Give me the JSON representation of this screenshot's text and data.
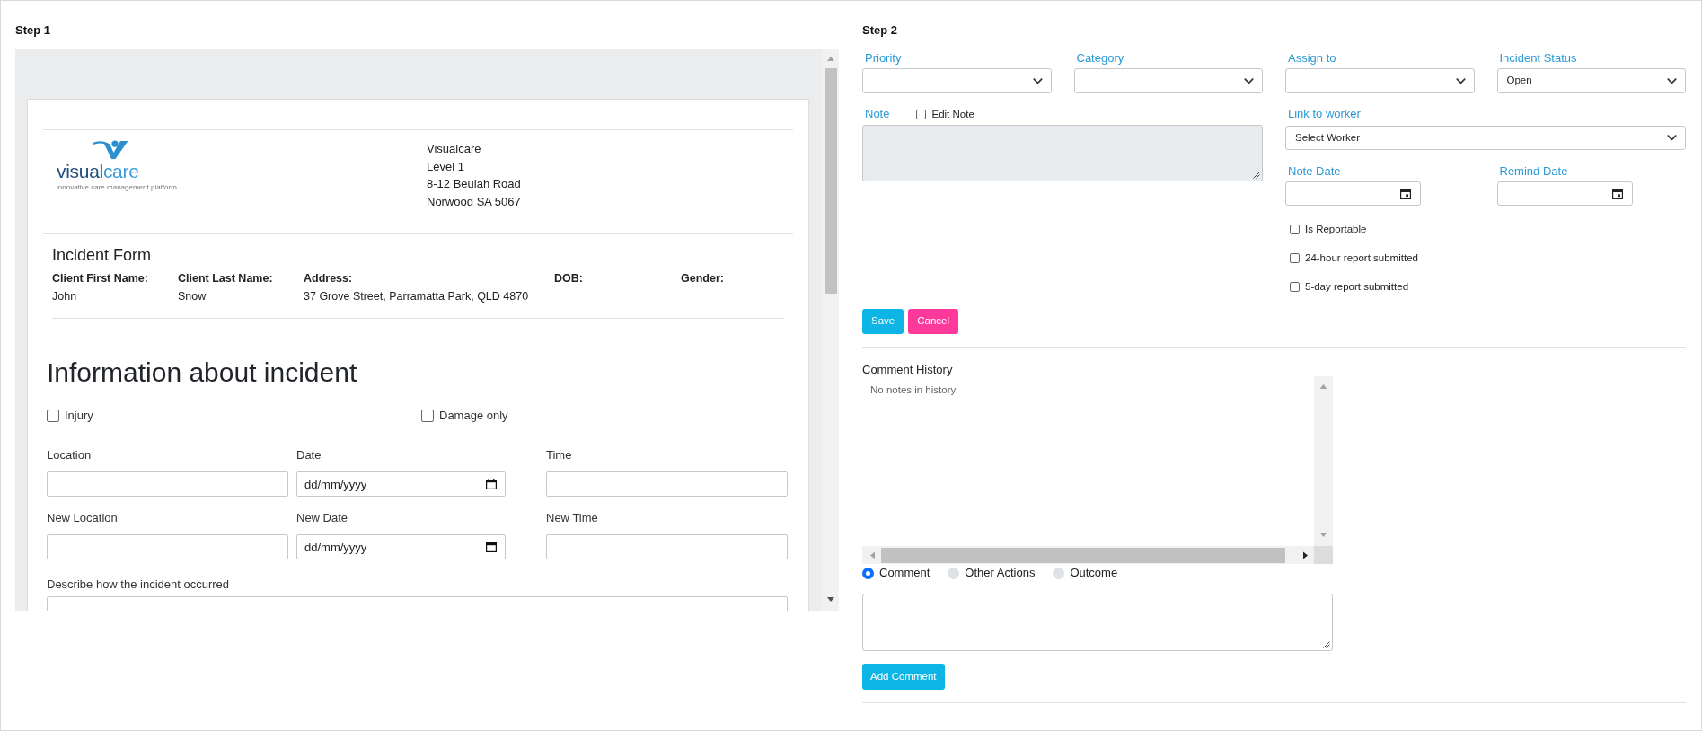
{
  "step1": {
    "title": "Step 1",
    "document": {
      "logo": {
        "wordmark_dark": "visual",
        "wordmark_light": "care",
        "tagline": "innovative care management platform"
      },
      "company_address": [
        "Visualcare",
        "Level 1",
        "8-12 Beulah Road",
        "Norwood SA 5067"
      ],
      "form_title": "Incident Form",
      "client_fields": [
        {
          "label": "Client First Name:",
          "value": "John"
        },
        {
          "label": "Client Last Name:",
          "value": "Snow"
        },
        {
          "label": "Address:",
          "value": "37 Grove Street, Parramatta Park, QLD 4870"
        },
        {
          "label": "DOB:"
        },
        {
          "label": "Gender:"
        }
      ],
      "section_title": "Information about incident",
      "checkboxes": [
        {
          "label": "Injury",
          "checked": false
        },
        {
          "label": "Damage only",
          "checked": false
        }
      ],
      "field_rows": [
        [
          {
            "label": "Location",
            "kind": "text"
          },
          {
            "label": "Date",
            "kind": "date",
            "placeholder": "dd/mm/yyyy"
          },
          {
            "label": "Time",
            "kind": "text"
          }
        ],
        [
          {
            "label": "New Location",
            "kind": "text"
          },
          {
            "label": "New Date",
            "kind": "date",
            "placeholder": "dd/mm/yyyy"
          },
          {
            "label": "New Time",
            "kind": "text"
          }
        ]
      ],
      "description": {
        "label": "Describe how the incident occurred"
      }
    }
  },
  "step2": {
    "title": "Step 2",
    "selects": [
      {
        "label": "Priority"
      },
      {
        "label": "Category"
      },
      {
        "label": "Assign to"
      },
      {
        "label": "Incident Status",
        "value": "Open"
      }
    ],
    "note": {
      "label": "Note",
      "disabled": true,
      "edit_checkbox": {
        "label": "Edit Note",
        "checked": false
      }
    },
    "link_to_worker": {
      "label": "Link to worker",
      "value": "Select Worker"
    },
    "dates": [
      {
        "label": "Note Date"
      },
      {
        "label": "Remind Date"
      }
    ],
    "checkboxes": [
      {
        "label": "Is Reportable",
        "checked": false
      },
      {
        "label": "24-hour report submitted",
        "checked": false
      },
      {
        "label": "5-day report submitted",
        "checked": false
      }
    ],
    "buttons": [
      {
        "label": "Save",
        "kind": "primary"
      },
      {
        "label": "Cancel",
        "kind": "danger"
      }
    ],
    "comment_history": {
      "title": "Comment History",
      "empty_text": "No notes in history"
    },
    "comment_types": [
      {
        "label": "Comment",
        "selected": true
      },
      {
        "label": "Other Actions",
        "selected": false
      },
      {
        "label": "Outcome",
        "selected": false
      }
    ],
    "add_comment_button": {
      "label": "Add Comment"
    }
  }
}
